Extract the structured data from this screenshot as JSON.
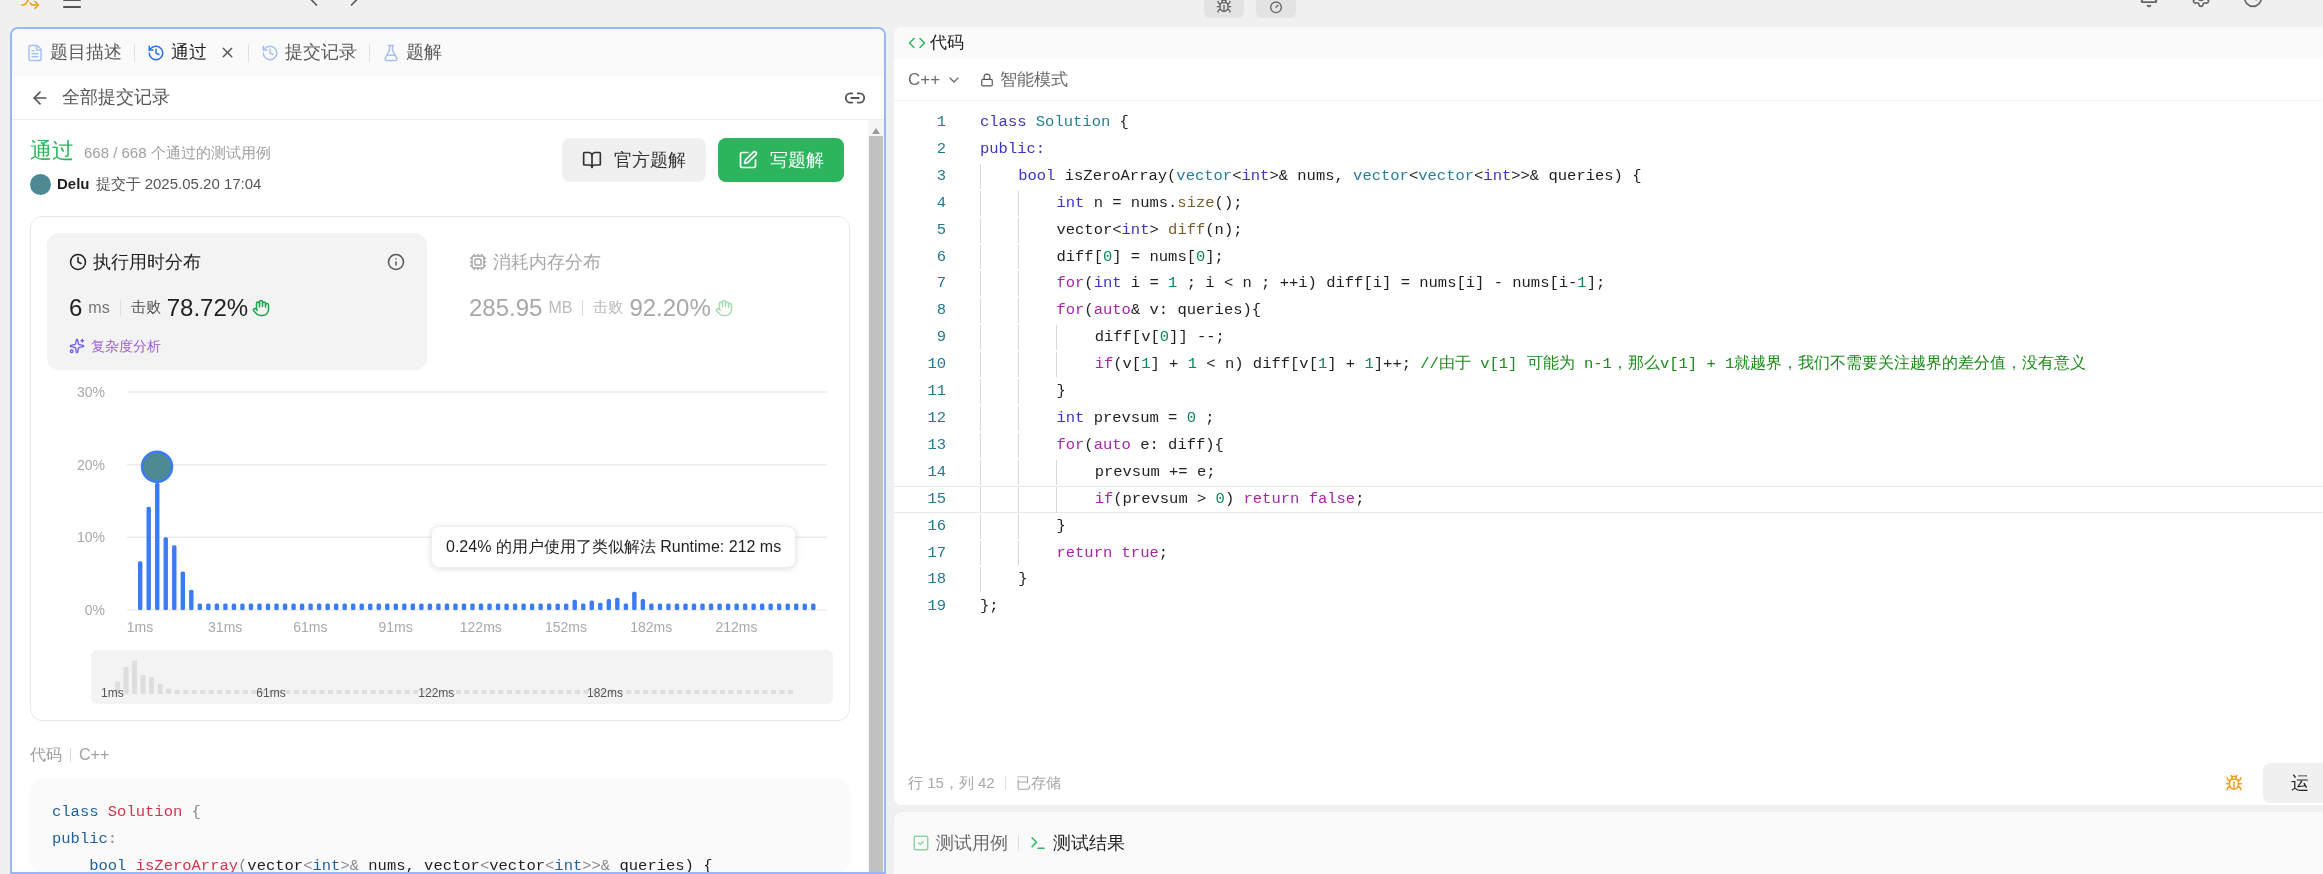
{
  "left_panel": {
    "tabs": [
      {
        "label": "题目描述",
        "selected": false,
        "closable": false
      },
      {
        "label": "通过",
        "selected": true,
        "closable": true
      },
      {
        "label": "提交记录",
        "selected": false,
        "closable": false
      },
      {
        "label": "题解",
        "selected": false,
        "closable": false
      }
    ],
    "back_link": "全部提交记录",
    "result": {
      "status": "通过",
      "cases": "668 / 668 个通过的测试用例",
      "user": "Delu",
      "submitted": "提交于 2025.05.20 17:04"
    },
    "buttons": [
      {
        "label": "官方题解",
        "kind": "secondary"
      },
      {
        "label": "写题解",
        "kind": "primary"
      }
    ],
    "stats": [
      {
        "title": "执行用时分布",
        "value": "6",
        "unit": "ms",
        "beats_label": "击败",
        "beats": "78.72%",
        "selected": true,
        "link": "复杂度分析"
      },
      {
        "title": "消耗内存分布",
        "value": "285.95",
        "unit": "MB",
        "beats_label": "击败",
        "beats": "92.20%",
        "selected": false
      }
    ],
    "chart_data": {
      "type": "bar",
      "ylim": [
        0,
        30
      ],
      "yticks": [
        {
          "value": 0,
          "label": "0%"
        },
        {
          "value": 10,
          "label": "10%"
        },
        {
          "value": 20,
          "label": "20%"
        },
        {
          "value": 30,
          "label": "30%"
        }
      ],
      "categories": [
        "1ms",
        null,
        null,
        null,
        null,
        null,
        null,
        null,
        null,
        null,
        "31ms",
        null,
        null,
        null,
        null,
        null,
        null,
        null,
        null,
        null,
        "61ms",
        null,
        null,
        null,
        null,
        null,
        null,
        null,
        null,
        null,
        "91ms",
        null,
        null,
        null,
        null,
        null,
        null,
        null,
        null,
        null,
        "122ms",
        null,
        null,
        null,
        null,
        null,
        null,
        null,
        null,
        null,
        "152ms",
        null,
        null,
        null,
        null,
        null,
        null,
        null,
        null,
        null,
        "182ms",
        null,
        null,
        null,
        null,
        null,
        null,
        null,
        null,
        null,
        "212ms",
        null,
        null,
        null,
        null,
        null,
        null,
        null,
        null,
        null
      ],
      "series": [
        {
          "color": "#3b7cf6",
          "values": [
            6.7,
            14.2,
            17.5,
            10,
            8.9,
            5.3,
            2.8,
            0.9,
            0.9,
            0.9,
            0.9,
            0.9,
            0.9,
            0.9,
            0.9,
            0.9,
            0.9,
            0.9,
            0.9,
            0.9,
            0.9,
            0.9,
            0.9,
            0.9,
            0.9,
            0.9,
            0.9,
            0.9,
            0.9,
            0.9,
            0.9,
            0.9,
            0.9,
            0.9,
            0.9,
            0.9,
            0.9,
            0.9,
            0.9,
            0.9,
            0.9,
            0.9,
            0.9,
            0.9,
            0.9,
            0.9,
            0.9,
            0.9,
            0.9,
            0.9,
            0.9,
            1.4,
            0.9,
            1.3,
            1.0,
            1.5,
            1.7,
            0.9,
            2.5,
            1.5,
            0.9,
            0.9,
            0.9,
            0.9,
            0.9,
            0.9,
            0.9,
            0.9,
            0.9,
            0.9,
            0.9,
            0.9,
            0.9,
            0.9,
            0.9,
            0.9,
            0.9,
            0.9,
            0.9,
            0.9
          ]
        }
      ]
    },
    "tooltip": "0.24% 的用户使用了类似解法 Runtime: 212 ms",
    "overview_labels": [
      "1ms",
      "61ms",
      "122ms",
      "182ms"
    ],
    "code_header": {
      "title": "代码",
      "language": "C++"
    },
    "code_preview": [
      [
        {
          "kind": "kw",
          "text": "class"
        },
        {
          "kind": "type",
          "text": " Solution"
        },
        {
          "kind": "punct",
          "text": " {"
        }
      ],
      [
        {
          "kind": "kw",
          "text": "public"
        },
        {
          "kind": "punct",
          "text": ":"
        }
      ],
      [
        {
          "kind": "kw",
          "text": "    bool"
        },
        {
          "kind": "fn",
          "text": " isZeroArray"
        },
        {
          "kind": "punct",
          "text": "("
        },
        {
          "kind": "plain",
          "text": "vector"
        },
        {
          "kind": "punct",
          "text": "<"
        },
        {
          "kind": "kw",
          "text": "int"
        },
        {
          "kind": "punct",
          "text": ">& "
        },
        {
          "kind": "plain",
          "text": "nums, vector"
        },
        {
          "kind": "punct",
          "text": "<"
        },
        {
          "kind": "plain",
          "text": "vector"
        },
        {
          "kind": "punct",
          "text": "<"
        },
        {
          "kind": "kw",
          "text": "int"
        },
        {
          "kind": "punct",
          "text": ">>& "
        },
        {
          "kind": "plain",
          "text": "queries) {"
        }
      ]
    ]
  },
  "editor": {
    "title": "代码",
    "language": "C++",
    "mode": "智能模式",
    "lines": [
      {
        "number": "1",
        "current": false,
        "tokens": [
          {
            "kind": "kw",
            "text": "class"
          },
          {
            "kind": "type",
            "text": " Solution"
          },
          {
            "kind": "plain",
            "text": " {"
          }
        ]
      },
      {
        "number": "2",
        "current": false,
        "tokens": [
          {
            "kind": "kw",
            "text": "public:"
          }
        ]
      },
      {
        "number": "3",
        "current": false,
        "tokens": [
          {
            "kind": "kw",
            "text": "    bool"
          },
          {
            "kind": "plain",
            "text": " isZeroArray("
          },
          {
            "kind": "type",
            "text": "vector"
          },
          {
            "kind": "plain",
            "text": "<"
          },
          {
            "kind": "kw",
            "text": "int"
          },
          {
            "kind": "plain",
            "text": ">& nums, "
          },
          {
            "kind": "type",
            "text": "vector"
          },
          {
            "kind": "plain",
            "text": "<"
          },
          {
            "kind": "type",
            "text": "vector"
          },
          {
            "kind": "plain",
            "text": "<"
          },
          {
            "kind": "kw",
            "text": "int"
          },
          {
            "kind": "plain",
            "text": ">>& queries) {"
          }
        ]
      },
      {
        "number": "4",
        "current": false,
        "tokens": [
          {
            "kind": "kw",
            "text": "        int"
          },
          {
            "kind": "plain",
            "text": " n = nums."
          },
          {
            "kind": "fn",
            "text": "size"
          },
          {
            "kind": "plain",
            "text": "();"
          }
        ]
      },
      {
        "number": "5",
        "current": false,
        "tokens": [
          {
            "kind": "plain",
            "text": "        vector<"
          },
          {
            "kind": "kw",
            "text": "int"
          },
          {
            "kind": "plain",
            "text": "> "
          },
          {
            "kind": "fn",
            "text": "diff"
          },
          {
            "kind": "plain",
            "text": "(n);"
          }
        ]
      },
      {
        "number": "6",
        "current": false,
        "tokens": [
          {
            "kind": "plain",
            "text": "        diff["
          },
          {
            "kind": "num",
            "text": "0"
          },
          {
            "kind": "plain",
            "text": "] = nums["
          },
          {
            "kind": "num",
            "text": "0"
          },
          {
            "kind": "plain",
            "text": "];"
          }
        ]
      },
      {
        "number": "7",
        "current": false,
        "tokens": [
          {
            "kind": "ctl",
            "text": "        for"
          },
          {
            "kind": "plain",
            "text": "("
          },
          {
            "kind": "kw",
            "text": "int"
          },
          {
            "kind": "plain",
            "text": " i = "
          },
          {
            "kind": "num",
            "text": "1"
          },
          {
            "kind": "plain",
            "text": " ; i < n ; ++i) diff[i] = nums[i] - nums[i-"
          },
          {
            "kind": "num",
            "text": "1"
          },
          {
            "kind": "plain",
            "text": "];"
          }
        ]
      },
      {
        "number": "8",
        "current": false,
        "tokens": [
          {
            "kind": "ctl",
            "text": "        for"
          },
          {
            "kind": "plain",
            "text": "("
          },
          {
            "kind": "ctl",
            "text": "auto"
          },
          {
            "kind": "plain",
            "text": "& v: queries){"
          }
        ]
      },
      {
        "number": "9",
        "current": false,
        "tokens": [
          {
            "kind": "plain",
            "text": "            diff[v["
          },
          {
            "kind": "num",
            "text": "0"
          },
          {
            "kind": "plain",
            "text": "]] --;"
          }
        ]
      },
      {
        "number": "10",
        "current": false,
        "tokens": [
          {
            "kind": "ctl",
            "text": "            if"
          },
          {
            "kind": "plain",
            "text": "(v["
          },
          {
            "kind": "num",
            "text": "1"
          },
          {
            "kind": "plain",
            "text": "] + "
          },
          {
            "kind": "num",
            "text": "1"
          },
          {
            "kind": "plain",
            "text": " < n) diff[v["
          },
          {
            "kind": "num",
            "text": "1"
          },
          {
            "kind": "plain",
            "text": "] + "
          },
          {
            "kind": "num",
            "text": "1"
          },
          {
            "kind": "plain",
            "text": "]++; "
          },
          {
            "kind": "comment",
            "text": "//由于 v[1] 可能为 n-1，那么v[1] + 1就越界，我们不需要关注越界的差分值，没有意义"
          }
        ]
      },
      {
        "number": "11",
        "current": false,
        "tokens": [
          {
            "kind": "plain",
            "text": "        }"
          }
        ]
      },
      {
        "number": "12",
        "current": false,
        "tokens": [
          {
            "kind": "kw",
            "text": "        int"
          },
          {
            "kind": "plain",
            "text": " prevsum = "
          },
          {
            "kind": "num",
            "text": "0"
          },
          {
            "kind": "plain",
            "text": " ;"
          }
        ]
      },
      {
        "number": "13",
        "current": false,
        "tokens": [
          {
            "kind": "ctl",
            "text": "        for"
          },
          {
            "kind": "plain",
            "text": "("
          },
          {
            "kind": "ctl",
            "text": "auto"
          },
          {
            "kind": "plain",
            "text": " e: diff){"
          }
        ]
      },
      {
        "number": "14",
        "current": false,
        "tokens": [
          {
            "kind": "plain",
            "text": "            prevsum += e;"
          }
        ]
      },
      {
        "number": "15",
        "current": true,
        "tokens": [
          {
            "kind": "ctl",
            "text": "            if"
          },
          {
            "kind": "plain",
            "text": "(prevsum > "
          },
          {
            "kind": "num",
            "text": "0"
          },
          {
            "kind": "plain",
            "text": ") "
          },
          {
            "kind": "ctl",
            "text": "return false"
          },
          {
            "kind": "plain",
            "text": ";"
          }
        ]
      },
      {
        "number": "16",
        "current": false,
        "tokens": [
          {
            "kind": "plain",
            "text": "        }"
          }
        ]
      },
      {
        "number": "17",
        "current": false,
        "tokens": [
          {
            "kind": "ctl",
            "text": "        return true"
          },
          {
            "kind": "plain",
            "text": ";"
          }
        ]
      },
      {
        "number": "18",
        "current": false,
        "tokens": [
          {
            "kind": "plain",
            "text": "    }"
          }
        ]
      },
      {
        "number": "19",
        "current": false,
        "tokens": [
          {
            "kind": "plain",
            "text": "};"
          }
        ]
      }
    ],
    "status": {
      "position": "行 15，列 42",
      "saved": "已存储"
    },
    "run_button": "运"
  },
  "bottom_panel": {
    "tabs": [
      {
        "label": "测试用例",
        "selected": false
      },
      {
        "label": "测试结果",
        "selected": true
      }
    ]
  }
}
